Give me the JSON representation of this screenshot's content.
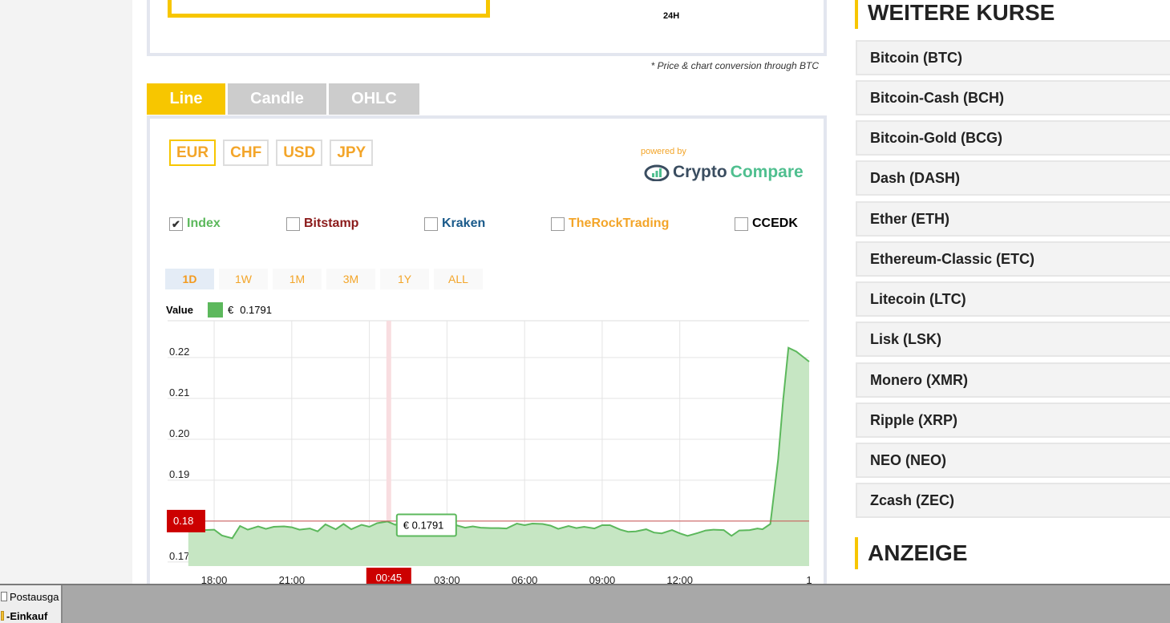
{
  "top_panel": {
    "time_label": "24H"
  },
  "conversion_note": "* Price & chart conversion through BTC",
  "tabs": [
    {
      "label": "Line",
      "active": true
    },
    {
      "label": "Candle",
      "active": false
    },
    {
      "label": "OHLC",
      "active": false
    }
  ],
  "currencies": [
    {
      "label": "EUR",
      "active": true
    },
    {
      "label": "CHF",
      "active": false
    },
    {
      "label": "USD",
      "active": false
    },
    {
      "label": "JPY",
      "active": false
    }
  ],
  "powered_by": {
    "text": "powered by",
    "brand_part1": "Crypto",
    "brand_part2": "Compare"
  },
  "exchanges": [
    {
      "label": "Index",
      "checked": true,
      "color": "#5cb85c"
    },
    {
      "label": "Bitstamp",
      "checked": false,
      "color": "#8b1a1a"
    },
    {
      "label": "Kraken",
      "checked": false,
      "color": "#1a5a8a"
    },
    {
      "label": "TheRockTrading",
      "checked": false,
      "color": "#f3a529"
    },
    {
      "label": "CCEDK",
      "checked": false,
      "color": "#000000"
    }
  ],
  "ranges": [
    {
      "label": "1D",
      "active": true
    },
    {
      "label": "1W",
      "active": false
    },
    {
      "label": "1M",
      "active": false
    },
    {
      "label": "3M",
      "active": false
    },
    {
      "label": "1Y",
      "active": false
    },
    {
      "label": "ALL",
      "active": false
    }
  ],
  "value_legend": {
    "label": "Value",
    "currency": "€",
    "value": "0.1791",
    "color": "#5cb85c"
  },
  "chart_data": {
    "type": "area",
    "series": [
      {
        "color": "#5cb85c",
        "x_hours": [
          0,
          0.3,
          0.6,
          1,
          1.3,
          1.7,
          2,
          2.3,
          2.7,
          3,
          3.3,
          3.7,
          4,
          4.3,
          4.7,
          5,
          5.3,
          5.7,
          6,
          6.3,
          6.7,
          7,
          7.3,
          7.7,
          8,
          8.3,
          8.7,
          9,
          9.3,
          9.7,
          10,
          10.3,
          10.7,
          11,
          11.3,
          11.7,
          12,
          12.3,
          12.7,
          13,
          13.3,
          13.7,
          14,
          14.3,
          14.7,
          15,
          15.3,
          15.7,
          16,
          16.3,
          16.7,
          17,
          17.3,
          17.7,
          18,
          18.3,
          18.7,
          19,
          19.3,
          19.7,
          20,
          20.3,
          20.7,
          21,
          21.3,
          21.7,
          22,
          22.2,
          22.5,
          22.8,
          23,
          23.2,
          23.5,
          23.8,
          24
        ],
        "values": [
          0.1791,
          0.1775,
          0.1778,
          0.1779,
          0.1765,
          0.1758,
          0.1788,
          0.1779,
          0.1787,
          0.1781,
          0.1786,
          0.1787,
          0.1785,
          0.1779,
          0.1782,
          0.1775,
          0.1792,
          0.178,
          0.1793,
          0.178,
          0.1791,
          0.1786,
          0.1795,
          0.1799,
          0.1791,
          0.1799,
          0.1789,
          0.1792,
          0.1795,
          0.178,
          0.1789,
          0.1791,
          0.1784,
          0.1787,
          0.1784,
          0.1783,
          0.1783,
          0.1782,
          0.1794,
          0.179,
          0.1794,
          0.1793,
          0.1789,
          0.1781,
          0.1788,
          0.1783,
          0.1786,
          0.1782,
          0.179,
          0.179,
          0.1779,
          0.1774,
          0.1775,
          0.178,
          0.1772,
          0.177,
          0.1778,
          0.177,
          0.1764,
          0.1771,
          0.1777,
          0.1779,
          0.1778,
          0.1764,
          0.1777,
          0.1778,
          0.1782,
          0.178,
          0.1793,
          0.195,
          0.2098,
          0.2224,
          0.2215,
          0.22,
          0.219
        ]
      }
    ],
    "x_ticks": [
      "18:00",
      "21:00",
      "03:00",
      "06:00",
      "09:00",
      "12:00",
      "1"
    ],
    "y_ticks": [
      "0.22",
      "0.21",
      "0.20",
      "0.19",
      "0.17"
    ],
    "ylim": [
      0.169,
      0.229
    ],
    "crosshair": {
      "x_label": "00:45",
      "y_label": "0.18",
      "tooltip": "€ 0.1791"
    },
    "grid": true
  },
  "sidebar": {
    "heading": "WEITERE KURSE",
    "coins": [
      "Bitcoin (BTC)",
      "Bitcoin-Cash (BCH)",
      "Bitcoin-Gold (BCG)",
      "Dash (DASH)",
      "Ether (ETH)",
      "Ethereum-Classic (ETC)",
      "Litecoin (LTC)",
      "Lisk (LSK)",
      "Monero (XMR)",
      "Ripple (XRP)",
      "NEO (NEO)",
      "Zcash (ZEC)"
    ],
    "ad_heading": "ANZEIGE"
  },
  "taskbar": {
    "items": [
      "Postausga",
      "-Einkauf"
    ]
  }
}
